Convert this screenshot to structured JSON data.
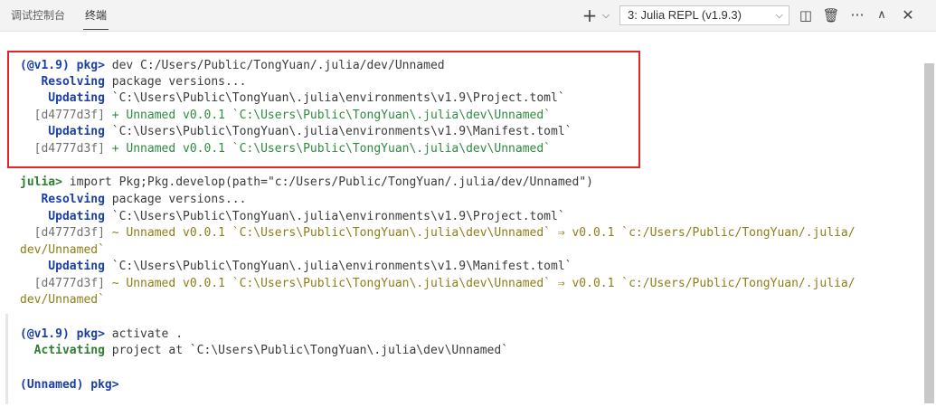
{
  "tabs": {
    "debug_console": "调试控制台",
    "terminal": "终端"
  },
  "toolbar": {
    "plus": "+",
    "plus_chevron": "⌵",
    "terminal_select": "3: Julia REPL (v1.9.3)",
    "select_chevron": "⌵",
    "split": "◫",
    "trash": "🗑",
    "more": "···",
    "maximize": "∧",
    "close": "✕"
  },
  "terminal": {
    "lines": [
      {
        "p1": "(@v1.9) pkg>",
        "p2": " dev C:/Users/Public/TongYuan/.julia/dev/Unnamed"
      },
      {
        "p1": "   Resolving",
        "p2": " package versions..."
      },
      {
        "p1": "    Updating",
        "p2": " `C:\\Users\\Public\\TongYuan\\.julia\\environments\\v1.9\\Project.toml`"
      },
      {
        "p1": "  [d4777d3f]",
        "p2": " + Unnamed v0.0.1 `C:\\Users\\Public\\TongYuan\\.julia\\dev\\Unnamed`"
      },
      {
        "p1": "    Updating",
        "p2": " `C:\\Users\\Public\\TongYuan\\.julia\\environments\\v1.9\\Manifest.toml`"
      },
      {
        "p1": "  [d4777d3f]",
        "p2": " + Unnamed v0.0.1 `C:\\Users\\Public\\TongYuan\\.julia\\dev\\Unnamed`"
      },
      {
        "p1": "julia>",
        "p2": " import Pkg;Pkg.develop(path=\"c:/Users/Public/TongYuan/.julia/dev/Unnamed\")"
      },
      {
        "p1": "   Resolving",
        "p2": " package versions..."
      },
      {
        "p1": "    Updating",
        "p2": " `C:\\Users\\Public\\TongYuan\\.julia\\environments\\v1.9\\Project.toml`"
      },
      {
        "p1": "  [d4777d3f]",
        "p2": " ~ Unnamed v0.0.1 `C:\\Users\\Public\\TongYuan\\.julia\\dev\\Unnamed` ⇒ v0.0.1 `c:/Users/Public/TongYuan/.julia/"
      },
      {
        "p1": "",
        "p2": "dev/Unnamed`"
      },
      {
        "p1": "    Updating",
        "p2": " `C:\\Users\\Public\\TongYuan\\.julia\\environments\\v1.9\\Manifest.toml`"
      },
      {
        "p1": "  [d4777d3f]",
        "p2": " ~ Unnamed v0.0.1 `C:\\Users\\Public\\TongYuan\\.julia\\dev\\Unnamed` ⇒ v0.0.1 `c:/Users/Public/TongYuan/.julia/"
      },
      {
        "p1": "",
        "p2": "dev/Unnamed`"
      },
      {
        "p1": "(@v1.9) pkg>",
        "p2": " activate ."
      },
      {
        "p1": "  Activating",
        "p2": " project at `C:\\Users\\Public\\TongYuan\\.julia\\dev\\Unnamed`"
      },
      {
        "p1": "(Unnamed) pkg>",
        "p2": ""
      }
    ]
  },
  "colors": {
    "prompt_blue": "#1a3fa6",
    "added_green": "#2e8b3f",
    "changed_olive": "#8a7f17",
    "highlight_red": "#e0262b"
  }
}
